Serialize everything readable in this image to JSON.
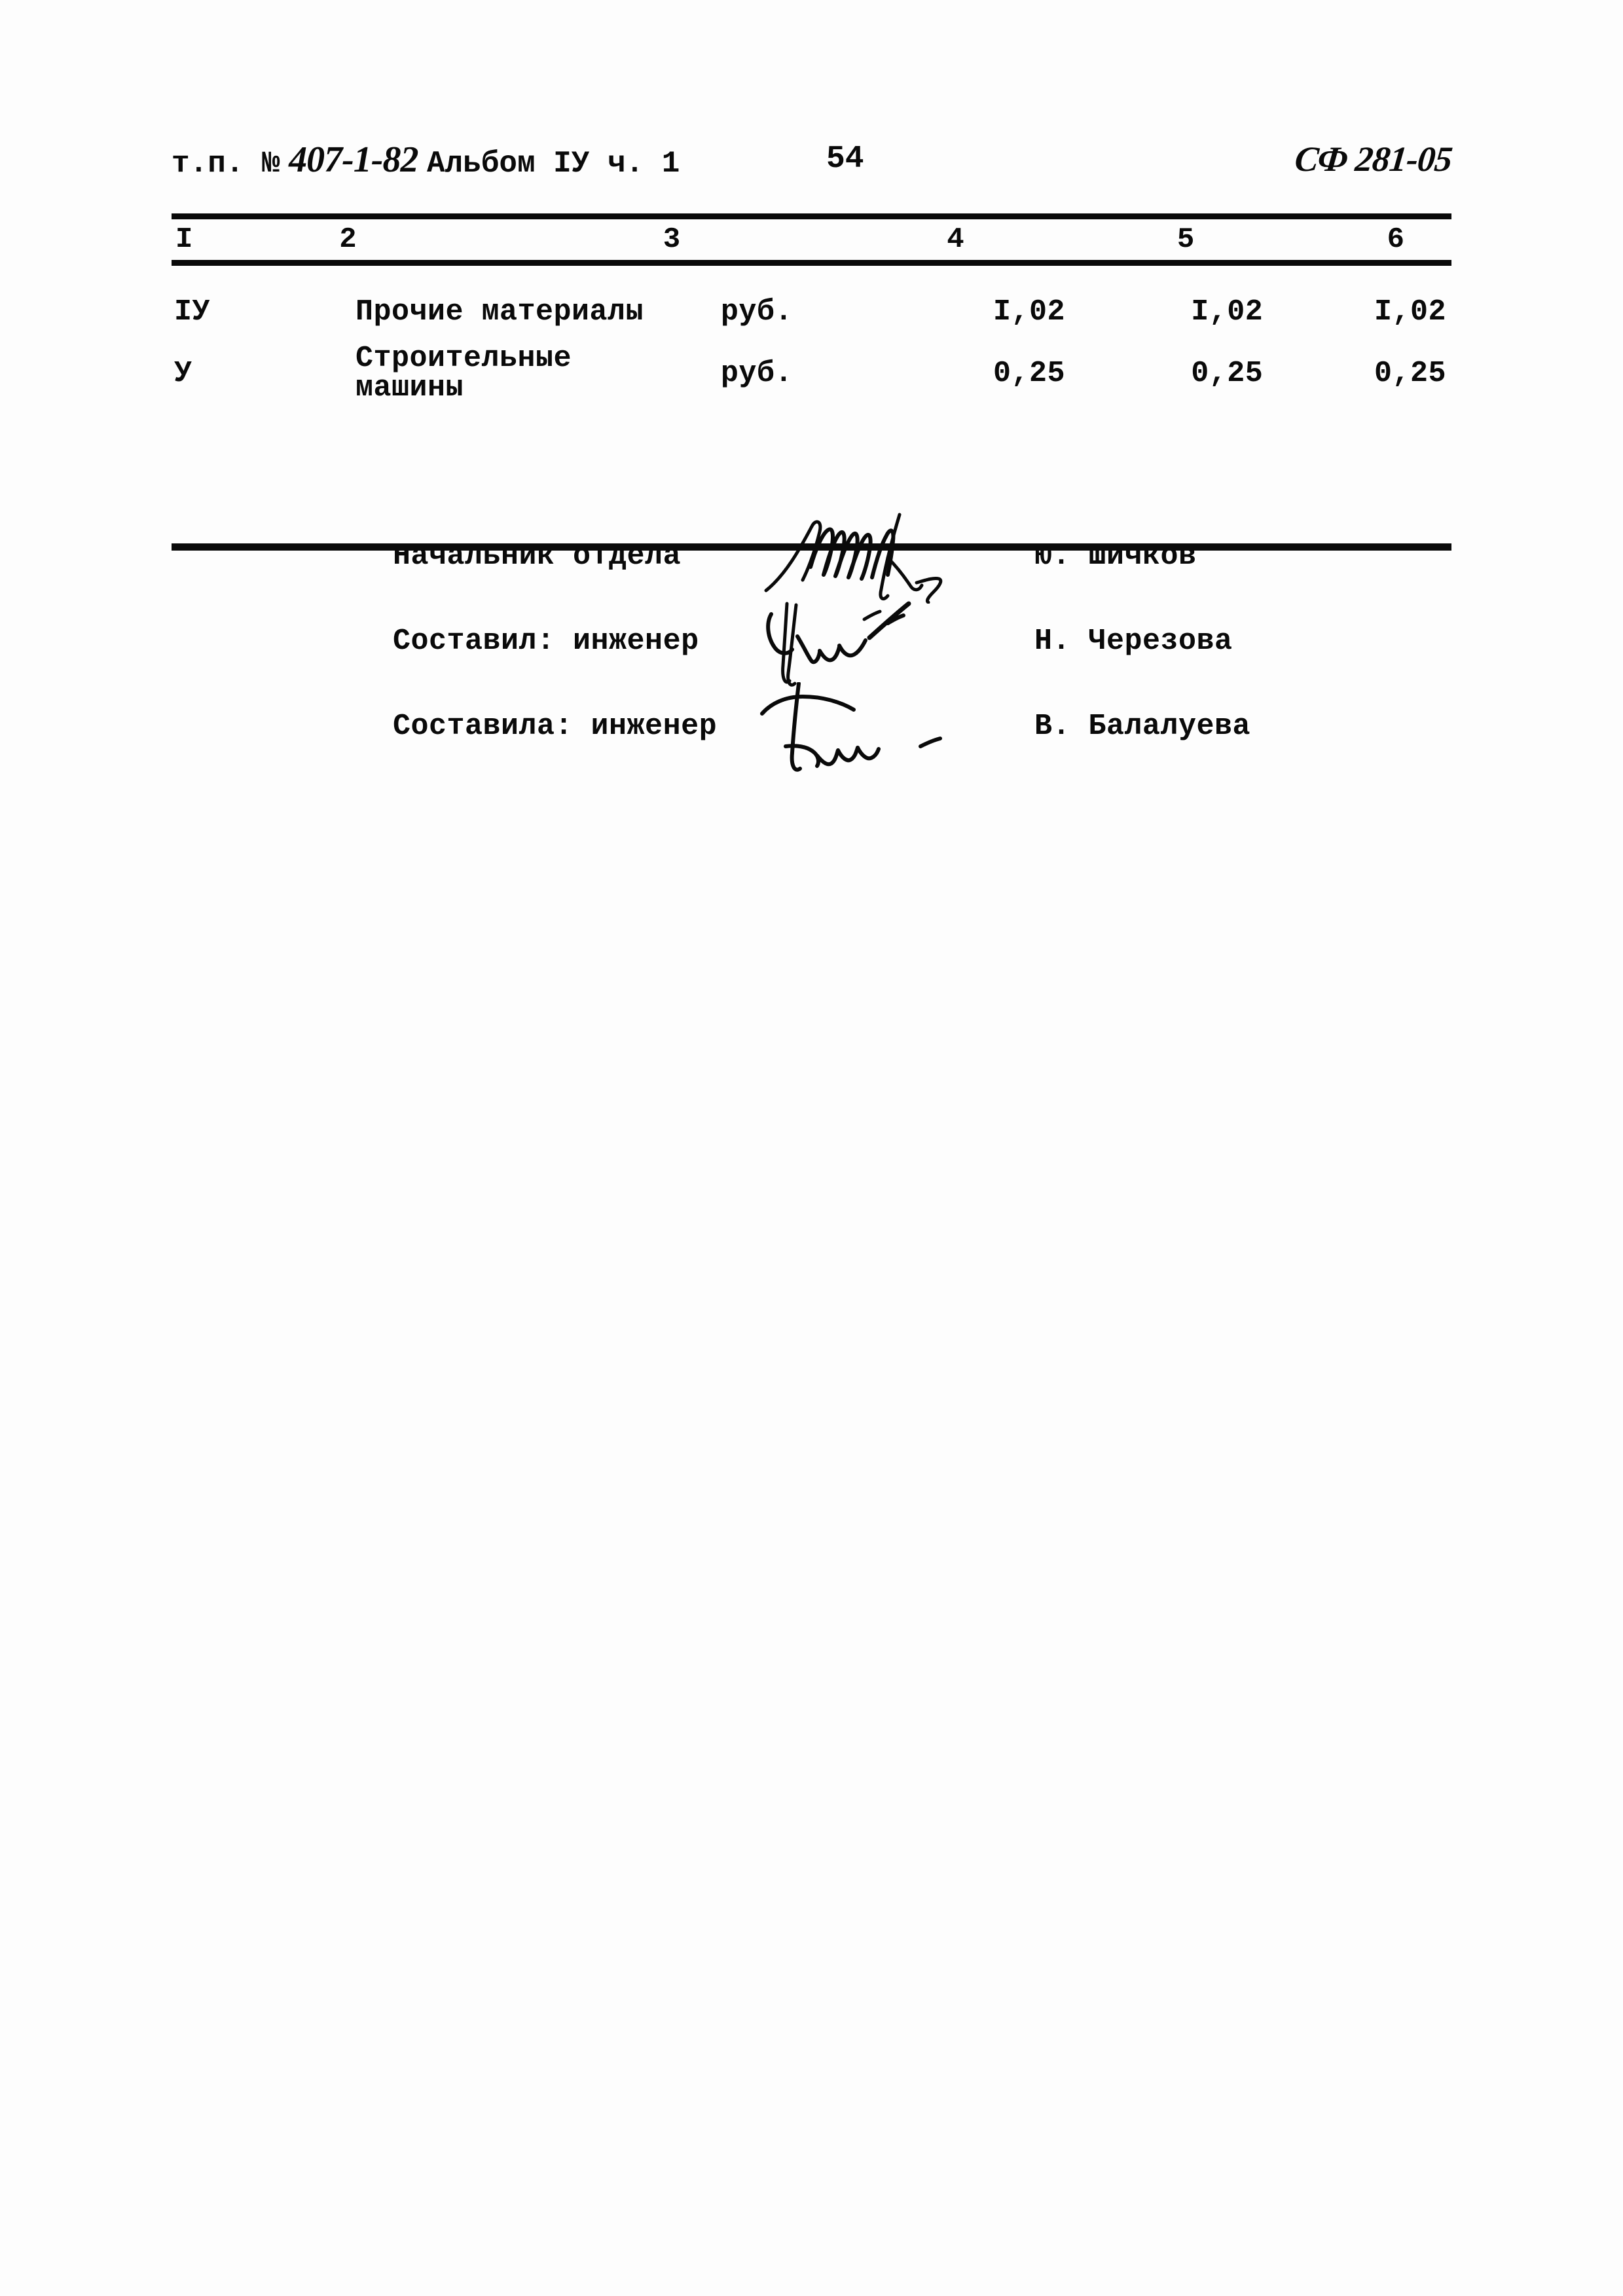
{
  "header": {
    "doc_prefix": "т.п. №",
    "doc_series": "407-1-82",
    "album": "Альбом IУ ч. 1",
    "doc_line": "т.п. № 407-1-82 Альбом IУ ч. 1",
    "page_number": "54",
    "stamp_code": "СФ 281-05"
  },
  "table": {
    "column_numbers": [
      "I",
      "2",
      "3",
      "4",
      "5",
      "6"
    ],
    "rows": [
      {
        "num": "IУ",
        "name": "Прочие материалы",
        "unit": "руб.",
        "v4": "I,02",
        "v5": "I,02",
        "v6": "I,02"
      },
      {
        "num": "У",
        "name": "Строительные машины",
        "unit": "руб.",
        "v4": "0,25",
        "v5": "0,25",
        "v6": "0,25"
      }
    ]
  },
  "signatures": [
    {
      "title": "Начальник отдела",
      "name": "Ю. Шичков",
      "mark": "signature-mark"
    },
    {
      "title": "Составил: инженер",
      "name": "Н. Черезова",
      "mark": "signature-mark"
    },
    {
      "title": "Составила: инженер",
      "name": "В. Балалуева",
      "mark": "signature-mark"
    }
  ],
  "colors": {
    "ink": "#0a0a0a",
    "paper": "#fdfdfd"
  }
}
